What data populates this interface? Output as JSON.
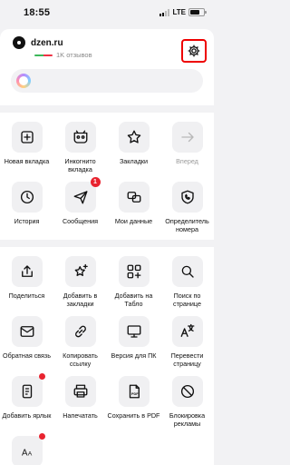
{
  "status": {
    "time": "18:55",
    "network": "LTE"
  },
  "site": {
    "name": "dzen.ru",
    "reviews": "1K отзывов"
  },
  "menu1": [
    {
      "label": "Новая вкладка",
      "icon": "plus-square-icon"
    },
    {
      "label": "Инкогнито вкладка",
      "icon": "incognito-icon"
    },
    {
      "label": "Закладки",
      "icon": "star-icon"
    },
    {
      "label": "Вперед",
      "icon": "arrow-right-icon",
      "disabled": true
    },
    {
      "label": "История",
      "icon": "clock-icon"
    },
    {
      "label": "Сообщения",
      "icon": "paper-plane-icon",
      "badge": "1"
    },
    {
      "label": "Мои данные",
      "icon": "data-icon"
    },
    {
      "label": "Определитель номера",
      "icon": "phone-shield-icon"
    }
  ],
  "menu2": [
    {
      "label": "Поделиться",
      "icon": "share-icon"
    },
    {
      "label": "Добавить в закладки",
      "icon": "star-plus-icon"
    },
    {
      "label": "Добавить на Табло",
      "icon": "grid-plus-icon"
    },
    {
      "label": "Поиск по странице",
      "icon": "search-icon"
    },
    {
      "label": "Обратная связь",
      "icon": "envelope-icon"
    },
    {
      "label": "Копировать ссылку",
      "icon": "link-icon"
    },
    {
      "label": "Версия для ПК",
      "icon": "monitor-icon"
    },
    {
      "label": "Перевести страницу",
      "icon": "translate-icon"
    },
    {
      "label": "Добавить ярлык",
      "icon": "shortcut-icon",
      "dot": true
    },
    {
      "label": "Напечатать",
      "icon": "printer-icon"
    },
    {
      "label": "Сохранить в PDF",
      "icon": "pdf-icon"
    },
    {
      "label": "Блокировка рекламы",
      "icon": "block-icon"
    },
    {
      "label": "",
      "icon": "font-size-icon",
      "dot": true
    }
  ]
}
